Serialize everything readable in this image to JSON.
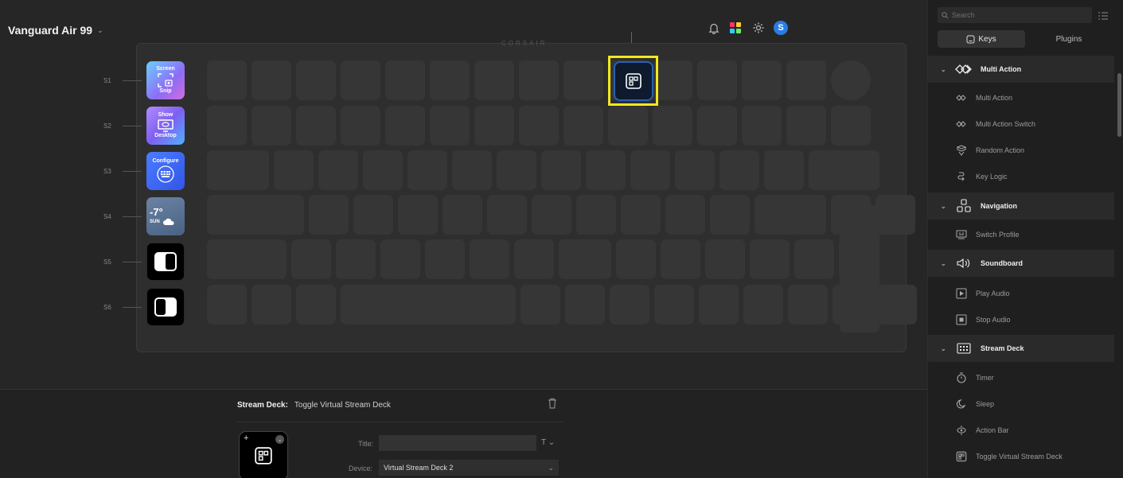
{
  "header": {
    "device_name": "Vanguard Air 99",
    "brand": "CORSAIR"
  },
  "top_icons": [
    {
      "name": "notification-bell-icon"
    },
    {
      "name": "marketplace-icon"
    },
    {
      "name": "settings-gear-icon"
    },
    {
      "name": "user-avatar",
      "label": "S"
    }
  ],
  "s_keys": [
    {
      "label": "S1",
      "text_top": "Screen",
      "text_bottom": "Snip",
      "icon": "screenshot-icon"
    },
    {
      "label": "S2",
      "text_top": "Show",
      "text_bottom": "Desktop",
      "icon": "desktop-icon"
    },
    {
      "label": "S3",
      "text_top": "Configure",
      "text_bottom": "",
      "icon": "keypad-icon"
    },
    {
      "label": "S4",
      "text_top": "-7°",
      "text_bottom": "SUN",
      "icon": "cloud-icon"
    },
    {
      "label": "S5",
      "text_top": "",
      "text_bottom": "",
      "icon": "toggle-left-icon"
    },
    {
      "label": "S6",
      "text_top": "",
      "text_bottom": "",
      "icon": "toggle-right-icon"
    }
  ],
  "inspector": {
    "plugin": "Stream Deck:",
    "action": "Toggle Virtual Stream Deck",
    "title_label": "Title:",
    "title_value": "",
    "title_format": "T ⌄",
    "device_label": "Device:",
    "device_value": "Virtual Stream Deck 2"
  },
  "sidebar": {
    "search_placeholder": "Search",
    "tabs": [
      {
        "label": "Keys",
        "active": true
      },
      {
        "label": "Plugins",
        "active": false
      }
    ],
    "categories": [
      {
        "label": "Multi Action",
        "items": [
          "Multi Action",
          "Multi Action Switch",
          "Random Action",
          "Key Logic"
        ]
      },
      {
        "label": "Navigation",
        "items": [
          "Switch Profile"
        ]
      },
      {
        "label": "Soundboard",
        "items": [
          "Play Audio",
          "Stop Audio"
        ]
      },
      {
        "label": "Stream Deck",
        "items": [
          "Timer",
          "Sleep",
          "Action Bar",
          "Toggle Virtual Stream Deck"
        ]
      }
    ]
  },
  "colors": {
    "highlight": "#f1e81c",
    "accent_blue": "#2a7de1",
    "background": "#262626"
  }
}
